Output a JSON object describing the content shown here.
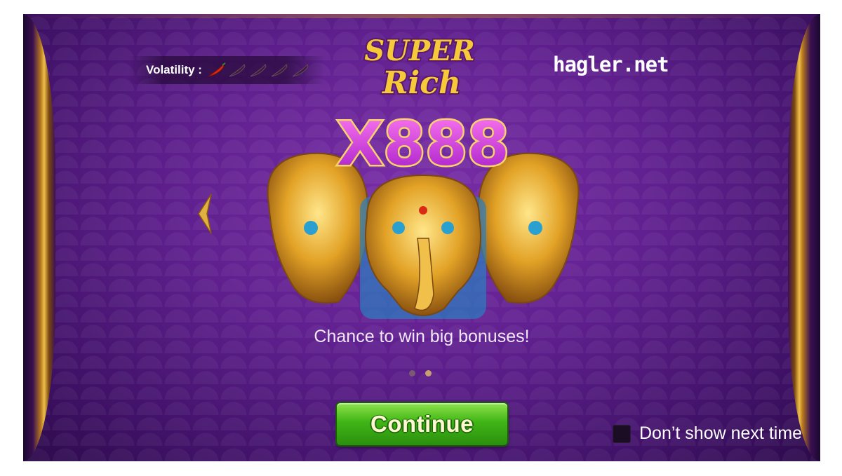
{
  "header": {
    "volatility_label": "Volatility :",
    "volatility_level": 1,
    "volatility_max": 5,
    "logo_text": "Super Rich",
    "watermark": "hagler.net"
  },
  "slide": {
    "multiplier": "X888",
    "tagline": "Chance to win big bonuses!",
    "total_slides": 2,
    "current_slide": 2
  },
  "actions": {
    "continue_label": "Continue",
    "dont_show_label": "Don’t show next time",
    "dont_show_checked": false
  },
  "colors": {
    "background": "#5e1f8d",
    "accent_gold": "#f0c04a",
    "button_green": "#3fb516",
    "chili_active": "#d82a14"
  }
}
